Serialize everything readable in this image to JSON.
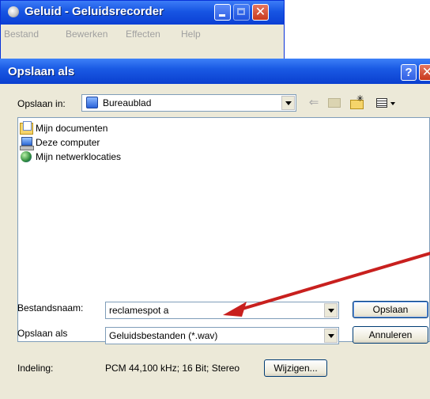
{
  "background_window": {
    "title": "Geluid - Geluidsrecorder",
    "menu": [
      "Bestand",
      "Bewerken",
      "Effecten",
      "Help"
    ]
  },
  "dialog": {
    "title": "Opslaan als",
    "help_glyph": "?",
    "close_glyph": "X",
    "look_in": {
      "label": "Opslaan in:",
      "value": "Bureaublad"
    },
    "toolbar_icons": [
      "back-arrow-icon",
      "up-folder-icon",
      "new-folder-icon",
      "view-menu-icon"
    ],
    "files": [
      {
        "name": "Mijn documenten",
        "icon": "my-documents-icon"
      },
      {
        "name": "Deze computer",
        "icon": "my-computer-icon"
      },
      {
        "name": "Mijn netwerklocaties",
        "icon": "network-places-icon"
      }
    ],
    "filename": {
      "label": "Bestandsnaam:",
      "value": "reclamespot a"
    },
    "save_type": {
      "label": "Opslaan als",
      "value": "Geluidsbestanden (*.wav)"
    },
    "format": {
      "label": "Indeling:",
      "value": "PCM 44,100 kHz; 16 Bit; Stereo"
    },
    "buttons": {
      "save": "Opslaan",
      "cancel": "Annuleren",
      "change": "Wijzigen..."
    }
  },
  "annotation": {
    "color": "#c8201e",
    "points_to": "filename-field"
  }
}
